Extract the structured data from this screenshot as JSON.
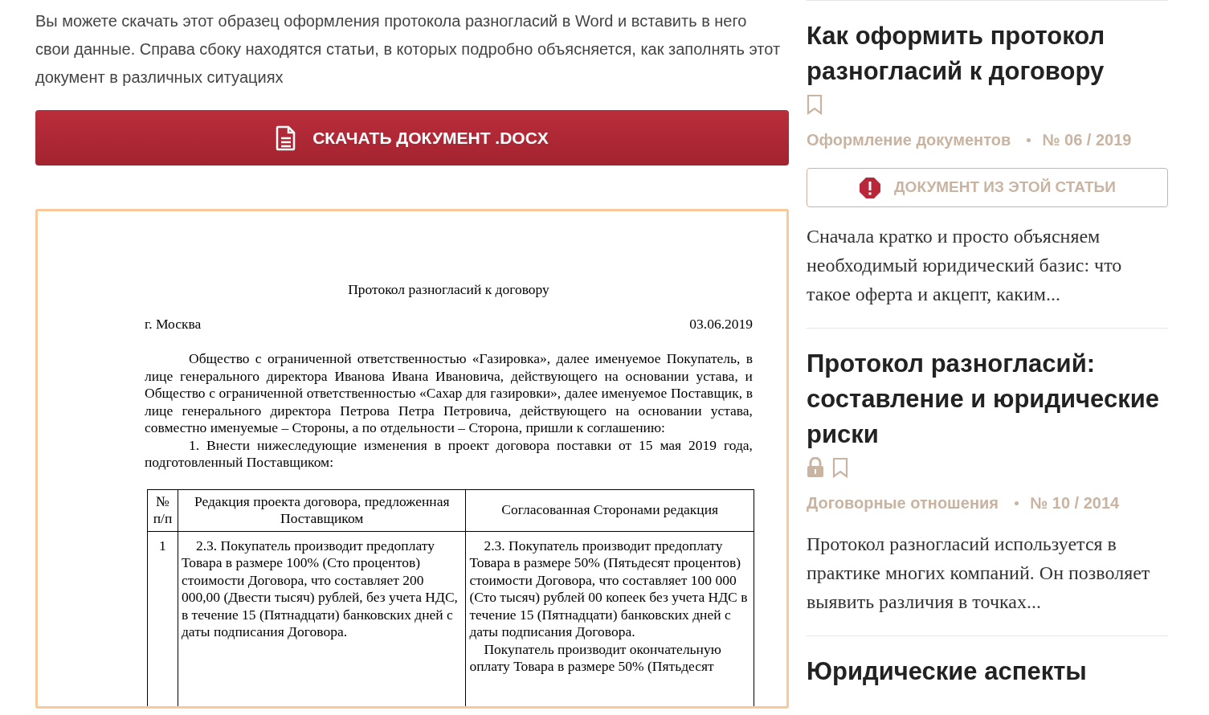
{
  "intro": "Вы можете скачать этот образец оформления протокола разногласий в Word и вставить в него свои данные. Справа сбоку находятся статьи, в которых подробно объясняется, как заполнять этот документ в различных ситуациях",
  "download_button": "СКАЧАТЬ ДОКУМЕНТ .DOCX",
  "document": {
    "title": "Протокол разногласий к договору",
    "city": "г. Москва",
    "date": "03.06.2019",
    "paragraphs": [
      "Общество с ограниченной ответственностью «Газировка», далее именуемое Покупатель, в лице генерального директора Иванова Ивана Ивановича, действующего на основании устава, и Общество с ограниченной ответственностью «Сахар для газировки», далее именуемое Поставщик, в лице генерального директора Петрова Петра Петровича, действующего на основании устава, совместно именуемые – Стороны, а по отдельности – Сторона, пришли к соглашению:",
      "1. Внести нижеследующие изменения в проект договора поставки от 15 мая 2019 года, подготовленный Поставщиком:"
    ],
    "table": {
      "columns": [
        "№ п/п",
        "Редакция проекта договора, предложенная Поставщиком",
        "Согласованная Сторонами редакция"
      ],
      "rows": [
        {
          "cells": [
            [
              "1"
            ],
            [
              "2.3. Покупатель производит предоплату Товара в размере 100% (Сто процентов) стоимости Договора, что составляет 200 000,00 (Двести тысяч) рублей, без учета НДС, в течение 15 (Пятнадцати) банковских дней с даты подписания Договора."
            ],
            [
              "2.3. Покупатель производит предоплату Товара в размере 50% (Пятьдесят процентов) стоимости Договора, что составляет 100 000 (Сто тысяч) рублей 00 копеек без учета НДС в течение 15 (Пятнадцати) банковских дней с даты подписания Договора.",
              "Покупатель производит окончательную оплату Товара в размере 50% (Пятьдесят"
            ]
          ]
        }
      ]
    }
  },
  "sidebar": {
    "articles": [
      {
        "title": "Как оформить протокол разногласий к договору",
        "locked": false,
        "category": "Оформление документов",
        "issue": "№ 06 / 2019",
        "document_button": "ДОКУМЕНТ ИЗ ЭТОЙ СТАТЬИ",
        "excerpt": "Сначала кратко и просто объясняем необходимый юридический базис: что такое оферта и акцепт, каким..."
      },
      {
        "title": "Протокол разногласий: составление и юридические риски",
        "locked": true,
        "category": "Договорные отношения",
        "issue": "№ 10 / 2014",
        "excerpt": "Протокол разногласий используется в практике многих компаний. Он позволяет выявить различия в точках..."
      },
      {
        "title": "Юридические аспекты"
      }
    ]
  }
}
